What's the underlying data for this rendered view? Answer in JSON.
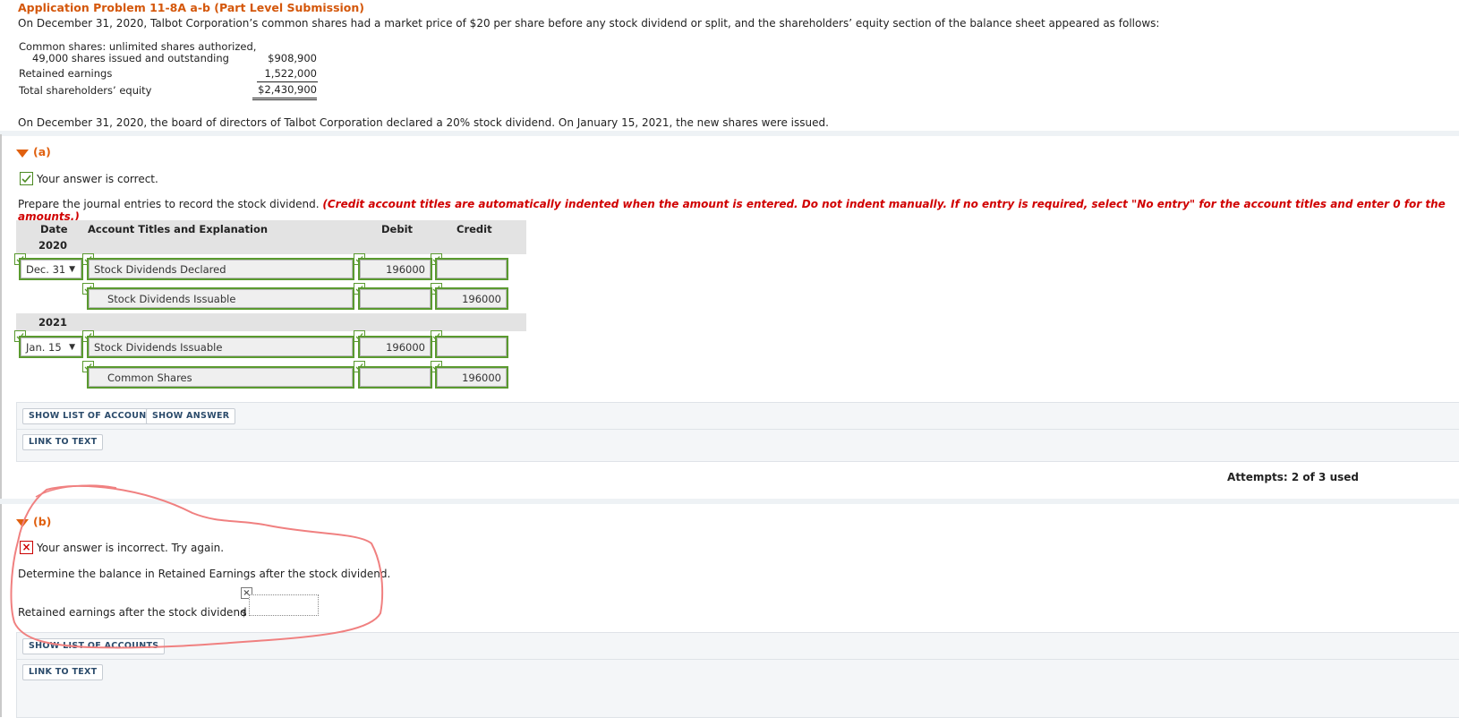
{
  "problem": {
    "title": "Application Problem 11-8A a-b (Part Level Submission)",
    "intro": "On December 31, 2020, Talbot Corporation’s common shares had a market price of $20 per share before any stock dividend or split, and the shareholders’ equity section of the balance sheet appeared as follows:",
    "balance_sheet": {
      "line1a": "Common shares: unlimited shares authorized,",
      "line1b": "49,000 shares issued and outstanding",
      "line1_amount": "$908,900",
      "line2": "Retained earnings",
      "line2_amount": "1,522,000",
      "line3": "Total shareholders’ equity",
      "line3_amount": "$2,430,900"
    },
    "declared": "On December 31, 2020, the board of directors of Talbot Corporation declared a 20% stock dividend. On January 15, 2021, the new shares were issued."
  },
  "part_a": {
    "label": "(a)",
    "status": "Your answer is correct.",
    "instruction": "Prepare the journal entries to record the stock dividend.",
    "instruction_note": "(Credit account titles are automatically indented when the amount is entered. Do not indent manually. If no entry is required, select \"No entry\" for the account titles and enter 0 for the amounts.)",
    "table": {
      "col_date": "Date",
      "col_account": "Account Titles and Explanation",
      "col_debit": "Debit",
      "col_credit": "Credit",
      "year1": "2020",
      "year2": "2021",
      "entries": [
        {
          "date": "Dec. 31",
          "account": "Stock Dividends Declared",
          "debit": "196000",
          "credit": ""
        },
        {
          "date": "",
          "account": "Stock Dividends Issuable",
          "debit": "",
          "credit": "196000"
        },
        {
          "date": "Jan. 15",
          "account": "Stock Dividends Issuable",
          "debit": "196000",
          "credit": ""
        },
        {
          "date": "",
          "account": "Common Shares",
          "debit": "",
          "credit": "196000"
        }
      ],
      "dropdown_arrow": "▼"
    },
    "buttons": {
      "show_list": "SHOW LIST OF ACCOUNTS",
      "show_answer": "SHOW ANSWER",
      "link_to_text": "LINK TO TEXT"
    },
    "attempts": "Attempts: 2 of 3 used"
  },
  "part_b": {
    "label": "(b)",
    "status": "Your answer is incorrect.  Try again.",
    "question": "Determine the balance in Retained Earnings after the stock dividend.",
    "field_label": "Retained earnings after the stock dividend",
    "currency": "$",
    "value": "",
    "buttons": {
      "show_list": "SHOW LIST OF ACCOUNTS",
      "link_to_text": "LINK TO TEXT"
    }
  },
  "colors": {
    "accent_orange": "#e0600f",
    "correct_green": "#5a9a2f",
    "incorrect_red": "#cc0000",
    "annotation_pink": "#f08080"
  }
}
